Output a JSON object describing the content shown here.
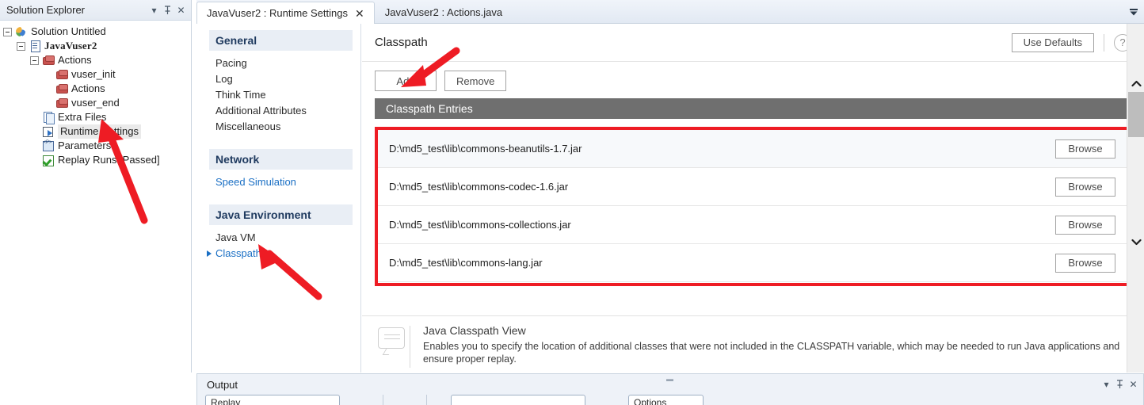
{
  "solution_explorer": {
    "title": "Solution Explorer",
    "buttons": [
      {
        "name": "dropdown",
        "glyph": "▾"
      },
      {
        "name": "pin",
        "glyph": "⇩"
      },
      {
        "name": "close",
        "glyph": "✕"
      }
    ],
    "tree": [
      {
        "label": "Solution Untitled",
        "icon": "solution-icon",
        "depth": 0,
        "expander": "minus",
        "style": "normal"
      },
      {
        "label": "JavaVuser2",
        "icon": "script-doc-icon",
        "depth": 1,
        "expander": "minus",
        "style": "bold"
      },
      {
        "label": "Actions",
        "icon": "brick-icon",
        "depth": 2,
        "expander": "minus",
        "style": "normal"
      },
      {
        "label": "vuser_init",
        "icon": "brick-icon",
        "depth": 3,
        "expander": "none",
        "style": "normal"
      },
      {
        "label": "Actions",
        "icon": "brick-icon",
        "depth": 3,
        "expander": "none",
        "style": "normal"
      },
      {
        "label": "vuser_end",
        "icon": "brick-icon",
        "depth": 3,
        "expander": "none",
        "style": "normal"
      },
      {
        "label": "Extra Files",
        "icon": "extra-files-icon",
        "depth": 2,
        "expander": "none",
        "style": "normal"
      },
      {
        "label": "Runtime Settings",
        "icon": "runtime-settings-icon",
        "depth": 2,
        "expander": "none",
        "style": "selected"
      },
      {
        "label": "Parameters",
        "icon": "parameters-icon",
        "depth": 2,
        "expander": "none",
        "style": "normal"
      },
      {
        "label": "Replay Runs [Passed]",
        "icon": "check-icon",
        "depth": 2,
        "expander": "none",
        "style": "normal"
      }
    ]
  },
  "tabbar": {
    "tabs": [
      {
        "label": "JavaVuser2 : Runtime Settings",
        "active": true,
        "close_glyph": "✕"
      },
      {
        "label": "JavaVuser2 : Actions.java",
        "active": false,
        "close_glyph": ""
      }
    ],
    "menu_glyph": "▼"
  },
  "settings_nav": {
    "groups": [
      {
        "header": "General",
        "items": [
          {
            "label": "Pacing",
            "state": "normal"
          },
          {
            "label": "Log",
            "state": "normal"
          },
          {
            "label": "Think Time",
            "state": "normal"
          },
          {
            "label": "Additional Attributes",
            "state": "normal"
          },
          {
            "label": "Miscellaneous",
            "state": "normal"
          }
        ]
      },
      {
        "header": "Network",
        "items": [
          {
            "label": "Speed Simulation",
            "state": "link"
          }
        ]
      },
      {
        "header": "Java Environment",
        "items": [
          {
            "label": "Java VM",
            "state": "normal"
          },
          {
            "label": "Classpath",
            "state": "selected"
          }
        ]
      }
    ]
  },
  "main": {
    "title": "Classpath",
    "use_defaults_label": "Use Defaults",
    "help_glyph": "?",
    "add_label": "Add",
    "remove_label": "Remove",
    "entries_header": "Classpath Entries",
    "browse_label": "Browse",
    "entries": [
      {
        "path": "D:\\md5_test\\lib\\commons-beanutils-1.7.jar"
      },
      {
        "path": "D:\\md5_test\\lib\\commons-codec-1.6.jar"
      },
      {
        "path": "D:\\md5_test\\lib\\commons-collections.jar"
      },
      {
        "path": "D:\\md5_test\\lib\\commons-lang.jar"
      }
    ],
    "info": {
      "title": "Java Classpath View",
      "body": "Enables you to specify the location of additional classes that were not included in the CLASSPATH variable, which may be needed to run Java applications and ensure proper replay."
    },
    "scroll": {
      "up_glyph": "⌃",
      "down_glyph": "⌄"
    }
  },
  "output": {
    "title": "Output",
    "buttons": [
      {
        "name": "dropdown",
        "glyph": "▾"
      },
      {
        "name": "pin",
        "glyph": "⇩"
      },
      {
        "name": "close",
        "glyph": "✕"
      }
    ],
    "toolbar": {
      "replay_value": "Replay",
      "search_value": "",
      "options_label": "Options"
    }
  },
  "annotations": {
    "accent_red": "#ee1c24",
    "arrows": [
      {
        "name": "arrow-to-runtime-settings"
      },
      {
        "name": "arrow-to-add-button"
      },
      {
        "name": "arrow-to-classpath-nav"
      }
    ]
  }
}
